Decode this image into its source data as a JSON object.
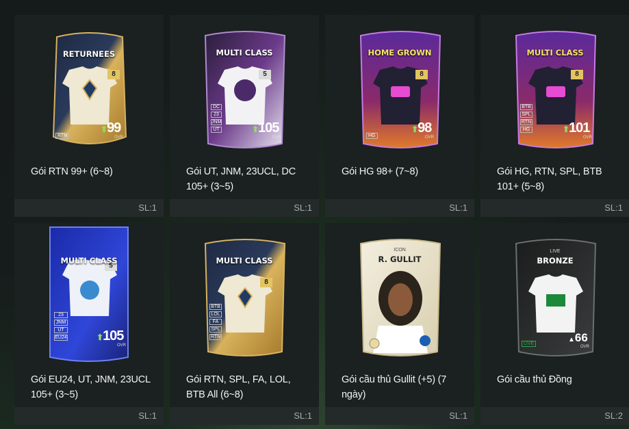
{
  "packs": [
    {
      "title": "Gói RTN 99+ (6~8)",
      "quantity": "SL:1",
      "card": {
        "banner": "RETURNEES",
        "level": "8",
        "ovr": "99",
        "ovr_label": "OVR",
        "tags": [
          "RTN"
        ],
        "theme": "returnees"
      }
    },
    {
      "title": "Gói UT, JNM, 23UCL, DC 105+ (3~5)",
      "quantity": "SL:1",
      "card": {
        "banner": "MULTI CLASS",
        "level": "5",
        "ovr": "105",
        "ovr_label": "OVR",
        "tags": [
          "DC",
          "23",
          "JNM",
          "UT"
        ],
        "theme": "purple"
      }
    },
    {
      "title": "Gói HG 98+ (7~8)",
      "quantity": "SL:1",
      "card": {
        "banner": "HOME GROWN",
        "level": "8",
        "ovr": "98",
        "ovr_label": "OVR",
        "tags": [
          "HG"
        ],
        "theme": "homegrown"
      }
    },
    {
      "title": "Gói HG, RTN, SPL, BTB 101+ (5~8)",
      "quantity": "SL:1",
      "card": {
        "banner": "MULTI CLASS",
        "level": "8",
        "ovr": "101",
        "ovr_label": "OVR",
        "tags": [
          "BTB",
          "SPL",
          "RTN",
          "HG"
        ],
        "theme": "homegrown"
      }
    },
    {
      "title": "Gói EU24, UT, JNM, 23UCL 105+ (3~5)",
      "quantity": "SL:1",
      "card": {
        "banner": "MULTI CLASS",
        "level": "5",
        "ovr": "105",
        "ovr_label": "OVR",
        "tags": [
          "23",
          "JNM",
          "UT",
          "EU24"
        ],
        "theme": "eu24"
      }
    },
    {
      "title": "Gói RTN, SPL, FA, LOL, BTB All (6~8)",
      "quantity": "SL:1",
      "card": {
        "banner": "MULTI CLASS",
        "level": "8",
        "ovr": "",
        "ovr_label": "",
        "tags": [
          "BTB",
          "LOL",
          "FA",
          "SPL",
          "RTN"
        ],
        "theme": "returnees"
      }
    },
    {
      "title": " Gói cầu thủ Gullit (+5) (7 ngày)",
      "quantity": "SL:1",
      "card": {
        "banner": "R. GULLIT",
        "sub": "ICON",
        "level": "",
        "ovr": "",
        "ovr_label": "",
        "tags": [],
        "theme": "icon"
      }
    },
    {
      "title": "Gói cầu thủ Đồng",
      "quantity": "SL:2",
      "card": {
        "banner": "BRONZE",
        "sub": "LIVE",
        "level": "",
        "ovr": "66",
        "ovr_label": "OVR",
        "tags": [
          "LIVE"
        ],
        "theme": "live"
      }
    }
  ],
  "colors": {
    "returnees": "#c9a24a",
    "purple": "#7a3fa8",
    "homegrown": "#a84bd0",
    "eu24": "#2a44c8",
    "icon": "#e8e1cf",
    "live": "#2b2d2d",
    "ovr_arrow": "#8fe05a",
    "tile_bg": "#1b2020",
    "footer_bg": "#242a2a"
  }
}
